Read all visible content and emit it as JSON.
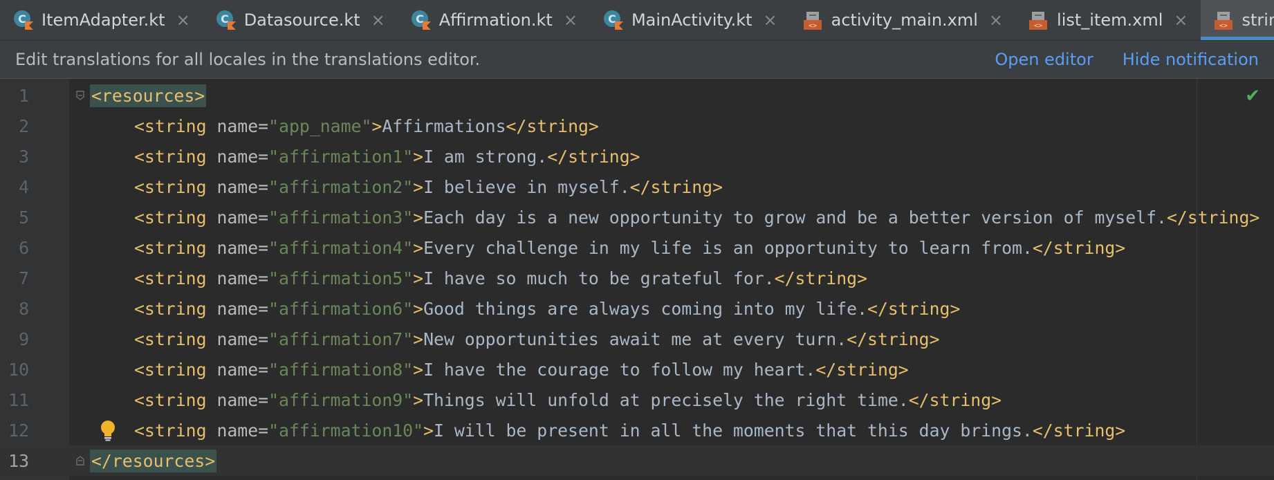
{
  "tabs": [
    {
      "label": "ItemAdapter.kt",
      "icon": "kotlin-class-icon"
    },
    {
      "label": "Datasource.kt",
      "icon": "kotlin-class-icon"
    },
    {
      "label": "Affirmation.kt",
      "icon": "kotlin-class-icon"
    },
    {
      "label": "MainActivity.kt",
      "icon": "kotlin-class-icon"
    },
    {
      "label": "activity_main.xml",
      "icon": "xml-layout-icon"
    },
    {
      "label": "list_item.xml",
      "icon": "xml-layout-icon"
    },
    {
      "label": "strings.xml",
      "icon": "xml-resource-icon",
      "active": true
    }
  ],
  "tab_close_glyph": "×",
  "notification": {
    "text": "Edit translations for all locales in the translations editor.",
    "open_editor": "Open editor",
    "hide_notification": "Hide notification"
  },
  "editor": {
    "line_numbers": [
      "1",
      "2",
      "3",
      "4",
      "5",
      "6",
      "7",
      "8",
      "9",
      "10",
      "11",
      "12",
      "13"
    ],
    "open_tag": "<resources>",
    "close_tag": "</resources>",
    "strings": [
      {
        "name": "app_name",
        "value": "Affirmations"
      },
      {
        "name": "affirmation1",
        "value": "I am strong."
      },
      {
        "name": "affirmation2",
        "value": "I believe in myself."
      },
      {
        "name": "affirmation3",
        "value": "Each day is a new opportunity to grow and be a better version of myself."
      },
      {
        "name": "affirmation4",
        "value": "Every challenge in my life is an opportunity to learn from."
      },
      {
        "name": "affirmation5",
        "value": "I have so much to be grateful for."
      },
      {
        "name": "affirmation6",
        "value": "Good things are always coming into my life."
      },
      {
        "name": "affirmation7",
        "value": "New opportunities await me at every turn."
      },
      {
        "name": "affirmation8",
        "value": "I have the courage to follow my heart."
      },
      {
        "name": "affirmation9",
        "value": "Things will unfold at precisely the right time."
      },
      {
        "name": "affirmation10",
        "value": "I will be present in all the moments that this day brings."
      }
    ],
    "syntax": {
      "string_open": "<string",
      "attr_name": " name=",
      "string_close": "</string>",
      "tag_end": ">"
    },
    "current_line": "13",
    "status_icon": "check-icon"
  },
  "colors": {
    "tag": "#e8bf6a",
    "attr_value": "#6a8759",
    "text": "#a9b7c6",
    "link": "#589df6",
    "active_tab_underline": "#4a88c7"
  }
}
